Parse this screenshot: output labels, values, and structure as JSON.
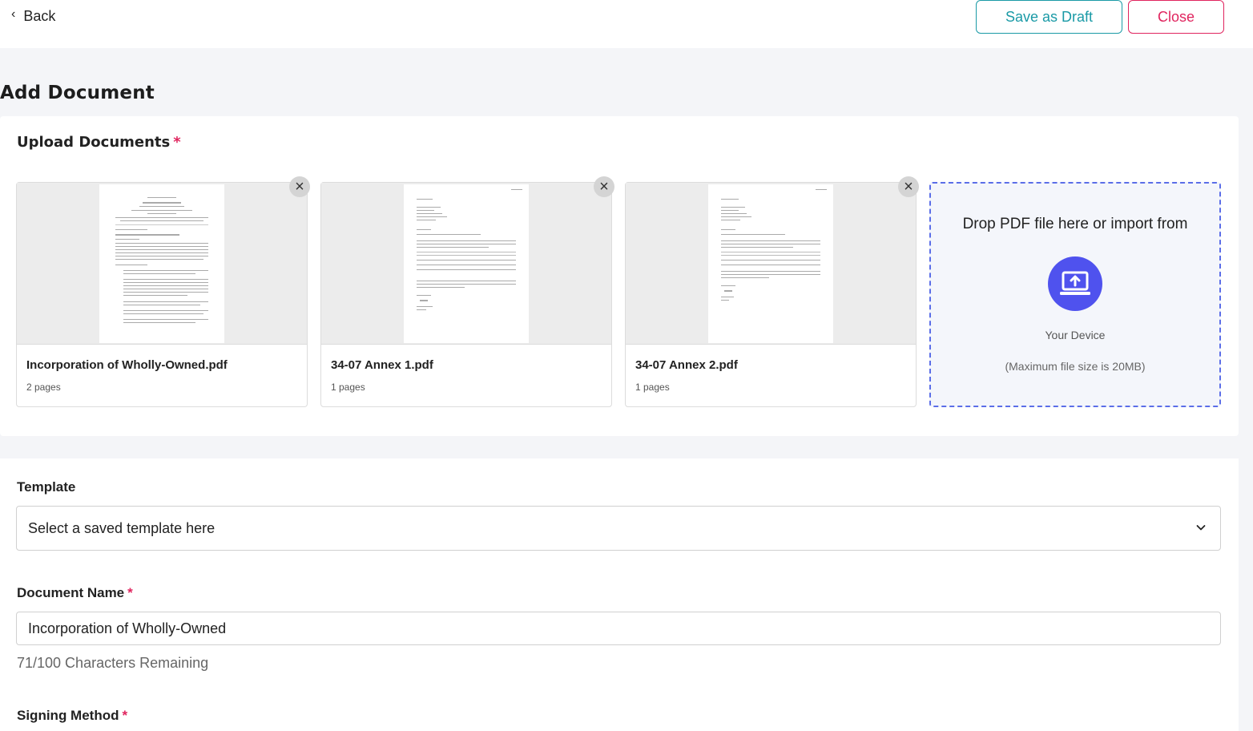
{
  "header": {
    "back_label": "Back",
    "save_draft_label": "Save as Draft",
    "close_label": "Close"
  },
  "page_title": "Add Document",
  "upload": {
    "label": "Upload Documents",
    "required_mark": "*",
    "files": [
      {
        "name": "Incorporation of Wholly-Owned.pdf",
        "pages": "2 pages"
      },
      {
        "name": "34-07 Annex 1.pdf",
        "pages": "1 pages"
      },
      {
        "name": "34-07 Annex 2.pdf",
        "pages": "1 pages"
      }
    ],
    "remove_symbol": "×",
    "dropzone": {
      "text": "Drop PDF file here or import from",
      "device_label": "Your Device",
      "max_size": "(Maximum file size is 20MB)"
    }
  },
  "form": {
    "template": {
      "label": "Template",
      "selected_value": "Select a saved template here"
    },
    "document_name": {
      "label": "Document Name",
      "required_mark": "*",
      "value": "Incorporation of Wholly-Owned",
      "remaining": "71/100 Characters Remaining"
    },
    "signing_method": {
      "label": "Signing Method",
      "required_mark": "*"
    }
  },
  "colors": {
    "teal": "#1a9aa6",
    "pink": "#e0245e",
    "accent": "#4f52ee"
  },
  "icons": {
    "back": "chevron-left-icon",
    "remove": "close-icon",
    "upload": "laptop-upload-icon",
    "select": "chevron-down-icon"
  }
}
